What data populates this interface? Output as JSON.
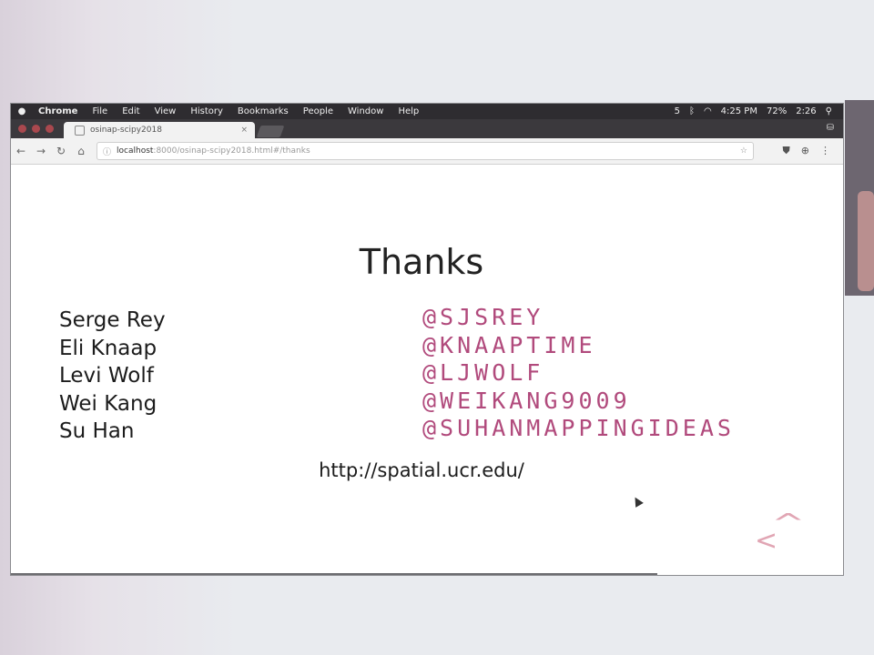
{
  "menubar": {
    "apple": "●",
    "app": "Chrome",
    "items": [
      "File",
      "Edit",
      "View",
      "History",
      "Bookmarks",
      "People",
      "Window",
      "Help"
    ],
    "status": {
      "badge": "5",
      "time": "4:25 PM",
      "battery": "72%",
      "clock": "2:26"
    }
  },
  "tab": {
    "title": "osinap-scipy2018",
    "close": "×"
  },
  "toolbar": {
    "back": "←",
    "forward": "→",
    "reload": "↻",
    "home": "⌂",
    "info": "ⓘ",
    "url_host": "localhost",
    "url_path": ":8000/osinap-scipy2018.html#/thanks",
    "star": "☆",
    "ext": "⛊",
    "menu": "⋮",
    "clock_ext": "⊕"
  },
  "slide": {
    "title": "Thanks",
    "people": [
      {
        "name": "Serge Rey",
        "handle": "@SJSREY"
      },
      {
        "name": "Eli Knaap",
        "handle": "@KNAAPTIME"
      },
      {
        "name": "Levi Wolf",
        "handle": "@LJWOLF"
      },
      {
        "name": "Wei Kang",
        "handle": "@WEIKANG9009"
      },
      {
        "name": "Su Han",
        "handle": "@SUHANMAPPINGIDEAS"
      }
    ],
    "url": "http://spatial.ucr.edu/",
    "nav_prev": "<",
    "nav_up": "^"
  },
  "colors": {
    "handle": "#b14a7c",
    "nav_arrows": "#e1a6b4"
  }
}
